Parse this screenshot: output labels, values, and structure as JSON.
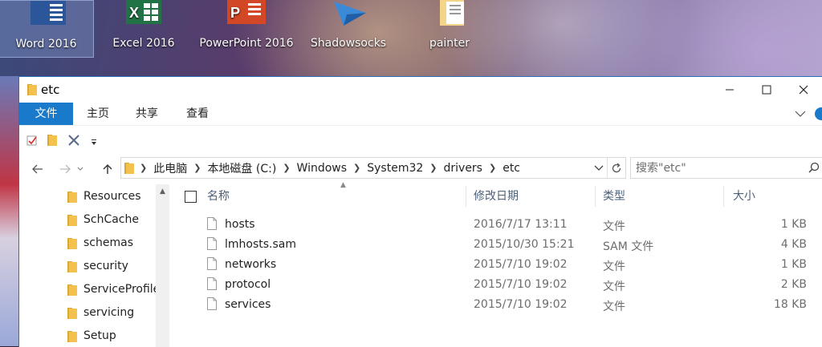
{
  "desktop": {
    "icons": [
      {
        "label": "Word 2016",
        "color": "#2b579a",
        "selected": true
      },
      {
        "label": "Excel 2016",
        "color": "#217346",
        "selected": false
      },
      {
        "label": "PowerPoint 2016",
        "color": "#d24726",
        "selected": false
      },
      {
        "label": "Shadowsocks",
        "color": "#3a8ad8",
        "selected": false
      },
      {
        "label": "painter",
        "color": "#e8c070",
        "selected": false
      }
    ]
  },
  "window": {
    "title": "etc",
    "controls": {
      "minimize": "—",
      "maximize": "☐",
      "close": "✕"
    }
  },
  "ribbon": {
    "tabs": [
      {
        "label": "文件",
        "active": true
      },
      {
        "label": "主页",
        "active": false
      },
      {
        "label": "共享",
        "active": false
      },
      {
        "label": "查看",
        "active": false
      }
    ],
    "expand_icon": "chevron-down-icon",
    "help_icon": "help-icon"
  },
  "quick_access": {
    "items": [
      "properties-icon",
      "new-folder-icon",
      "delete-icon",
      "customize-dropdown-icon"
    ]
  },
  "address": {
    "crumbs": [
      "此电脑",
      "本地磁盘 (C:)",
      "Windows",
      "System32",
      "drivers",
      "etc"
    ],
    "search_placeholder": "搜索\"etc\""
  },
  "nav_pane": {
    "items": [
      "Resources",
      "SchCache",
      "schemas",
      "security",
      "ServiceProfiles",
      "servicing",
      "Setup"
    ]
  },
  "file_list": {
    "columns": {
      "name": "名称",
      "modified": "修改日期",
      "type": "类型",
      "size": "大小"
    },
    "rows": [
      {
        "name": "hosts",
        "modified": "2016/7/17 13:11",
        "type": "文件",
        "size": "1 KB"
      },
      {
        "name": "lmhosts.sam",
        "modified": "2015/10/30 15:21",
        "type": "SAM 文件",
        "size": "4 KB"
      },
      {
        "name": "networks",
        "modified": "2015/7/10 19:02",
        "type": "文件",
        "size": "1 KB"
      },
      {
        "name": "protocol",
        "modified": "2015/7/10 19:02",
        "type": "文件",
        "size": "2 KB"
      },
      {
        "name": "services",
        "modified": "2015/7/10 19:02",
        "type": "文件",
        "size": "18 KB"
      }
    ]
  },
  "colors": {
    "accent": "#1979ca",
    "folder": "#f2c14e",
    "header_text": "#4c607a"
  }
}
